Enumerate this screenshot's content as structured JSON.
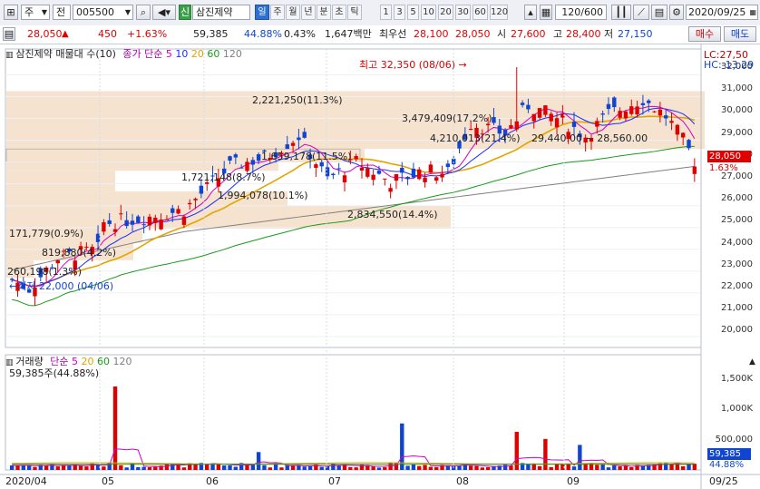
{
  "toolbar": {
    "market_select": "주",
    "type_select": "전",
    "code": "005500",
    "badge": "신",
    "name": "삼진제약",
    "periods": [
      "일",
      "주",
      "월",
      "년",
      "분",
      "초",
      "틱"
    ],
    "selected_period": "일",
    "minutes": [
      "1",
      "3",
      "5",
      "10",
      "20",
      "30",
      "60",
      "120"
    ],
    "count": "120",
    "total": "/600",
    "date": "2020/09/25"
  },
  "quote": {
    "price": "28,050",
    "arrow": "▲",
    "change": "450",
    "change_pct": "+1.63%",
    "volume": "59,385",
    "volume_ratio": "44.88%",
    "turnover_pct": "0.43%",
    "amount": "1,647백만",
    "best_ask_label": "최우선",
    "best_ask": "28,100",
    "best_bid": "28,050",
    "open_label": "시",
    "open": "27,600",
    "high_label": "고",
    "high": "28,400",
    "low_label": "저",
    "low": "27,150",
    "buy_label": "매수",
    "sell_label": "매도"
  },
  "price_panel": {
    "title": "삼진제약 매물대 수(10)",
    "ma_label": "종가 단순",
    "ma_periods": [
      "5",
      "10",
      "20",
      "60",
      "120"
    ],
    "lc": "LC:27,50",
    "hc": "HC:-13,29",
    "y_ticks": [
      "32,000",
      "31,000",
      "30,000",
      "29,000",
      "28,000",
      "27,000",
      "26,000",
      "25,000",
      "24,000",
      "23,000",
      "22,000",
      "21,000",
      "20,000"
    ],
    "current_tag": "28,050",
    "current_pct": "1.63%",
    "high_note": "최고 32,350 (08/06)",
    "low_note": "최저 22,000 (04/06)",
    "profile_labels": [
      "2,221,250(11.3%)",
      "3,479,409(17.2%)",
      "4,210,013(21.4%)",
      "29,440.00 ~ 28,560.00",
      "1,659,178(11.5%)",
      "1,721,148(8.7%)",
      "1,994,078(10.1%)",
      "2,834,550(14.4%)",
      "171,779(0.9%)",
      "819,880(4.2%)",
      "260,198(1.3%)"
    ]
  },
  "volume_panel": {
    "title": "거래량",
    "ma_label": "단순",
    "ma_periods": [
      "5",
      "20",
      "60",
      "120"
    ],
    "value_line": "59,385주(44.88%)",
    "y_ticks": [
      "1,500K",
      "1,000K",
      "500,000"
    ],
    "current_tag": "59,385",
    "current_pct": "44.88%"
  },
  "x_axis": [
    "2020/04",
    "05",
    "06",
    "07",
    "08",
    "09"
  ],
  "x_right": "09/25",
  "colors": {
    "up": "#e00000",
    "down": "#1045d4",
    "profile": "#f6e3cf",
    "ma5": "#d000c8",
    "ma10": "#1a2cff",
    "ma20": "#e3a400",
    "ma60": "#1a9a1a",
    "ma120": "#808080"
  },
  "chart_data": {
    "type": "candlestick",
    "y_range": [
      19500,
      32600
    ],
    "x": [
      "2020-04-01",
      "2020-09-25"
    ],
    "high": {
      "date": "2020-08-06",
      "value": 32350
    },
    "low": {
      "date": "2020-04-06",
      "value": 22000
    },
    "last": {
      "close": 28050,
      "open": 27600,
      "high": 28400,
      "low": 27150
    },
    "volume_peak_days": [
      "2020-04-27",
      "2020-06-22",
      "2020-07-27",
      "2020-08-06"
    ]
  }
}
